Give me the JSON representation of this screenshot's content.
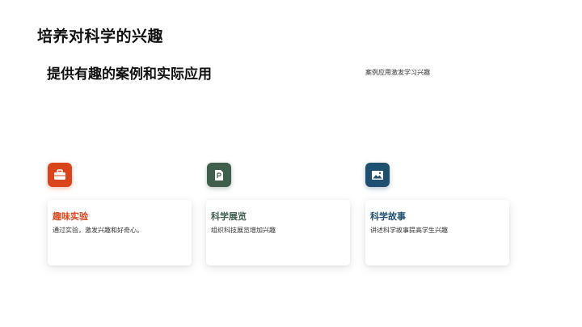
{
  "slide": {
    "title": "培养对科学的兴趣",
    "subtitle": "提供有趣的案例和实际应用",
    "side_note": "案例应用激发学习兴趣"
  },
  "cards": [
    {
      "title": "趣味实验",
      "description": "通过实验，激发兴趣和好奇心。",
      "icon": "briefcase-icon",
      "accent": "#d9441c"
    },
    {
      "title": "科学展览",
      "description": "组织科技展览增加兴趣",
      "icon": "document-icon",
      "accent": "#3f5e4e"
    },
    {
      "title": "科学故事",
      "description": "讲述科学故事提高学生兴趣",
      "icon": "image-icon",
      "accent": "#1f4f6e"
    }
  ]
}
